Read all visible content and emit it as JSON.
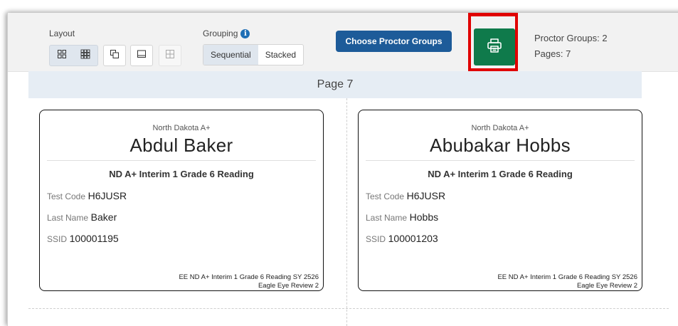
{
  "toolbar": {
    "layout_label": "Layout",
    "grouping_label": "Grouping",
    "grouping_options": [
      "Sequential",
      "Stacked"
    ],
    "grouping_selected": "Sequential",
    "choose_button": "Choose Proctor Groups",
    "print_icon": "printer-icon",
    "proctor_groups": "Proctor Groups: 2",
    "pages": "Pages: 7",
    "layout_icons": [
      "grid-2x2-icon",
      "grid-3x3-icon",
      "copies-icon",
      "single-page-icon",
      "quad-page-icon"
    ],
    "print_highlight_color": "#e00000",
    "print_button_color": "#0f7a4b",
    "choose_button_color": "#1d5b99"
  },
  "page_header": "Page 7",
  "cards": [
    {
      "state": "North Dakota A+",
      "name": "Abdul Baker",
      "test": "ND A+ Interim 1 Grade 6 Reading",
      "test_code_label": "Test Code",
      "test_code": "H6JUSR",
      "last_name_label": "Last Name",
      "last_name": "Baker",
      "ssid_label": "SSID",
      "ssid": "100001195",
      "footer_line1": "EE ND A+ Interim 1 Grade 6 Reading SY 2526",
      "footer_line2": "Eagle Eye Review 2"
    },
    {
      "state": "North Dakota A+",
      "name": "Abubakar Hobbs",
      "test": "ND A+ Interim 1 Grade 6 Reading",
      "test_code_label": "Test Code",
      "test_code": "H6JUSR",
      "last_name_label": "Last Name",
      "last_name": "Hobbs",
      "ssid_label": "SSID",
      "ssid": "100001203",
      "footer_line1": "EE ND A+ Interim 1 Grade 6 Reading SY 2526",
      "footer_line2": "Eagle Eye Review 2"
    }
  ]
}
